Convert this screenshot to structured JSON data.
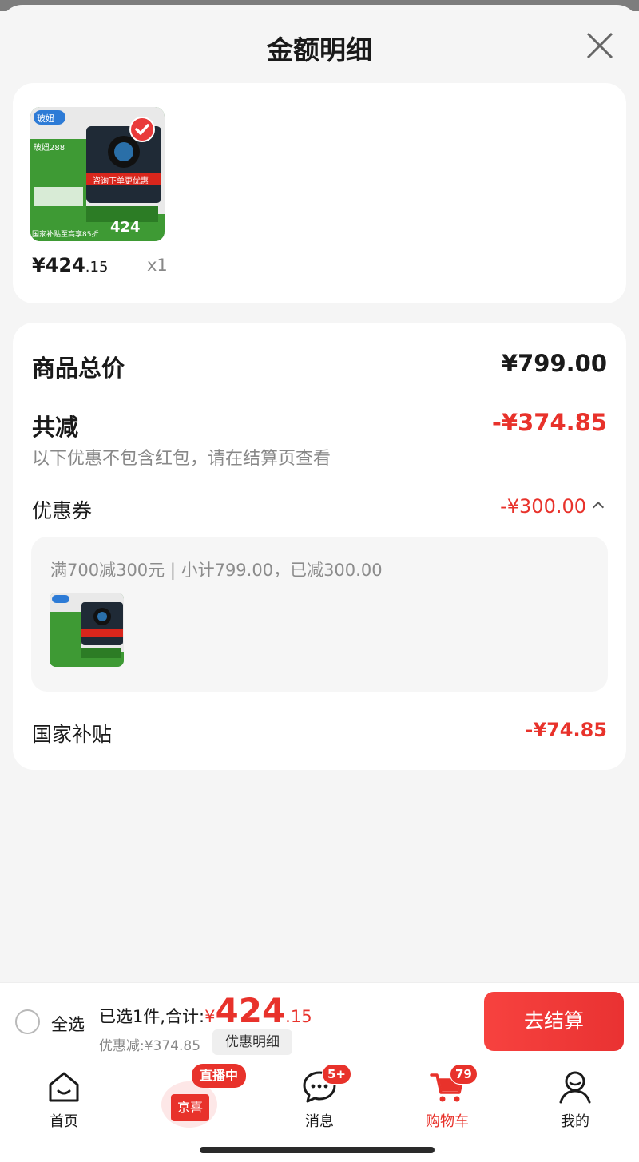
{
  "sheet": {
    "title": "金额明细"
  },
  "product": {
    "price_int": "¥424",
    "price_dec": ".15",
    "qty": "x1",
    "thumb_labels": {
      "brand": "玻妞",
      "model": "玻妞288",
      "banner": "咨询下单更优惠",
      "price": "424",
      "subsidy": "国家补贴至高享85折"
    }
  },
  "detail": {
    "goods_total_label": "商品总价",
    "goods_total_value": "¥799.00",
    "reduced_label": "共减",
    "reduced_value": "-¥374.85",
    "note": "以下优惠不包含红包，请在结算页查看",
    "coupon_label": "优惠券",
    "coupon_value": "-¥300.00",
    "coupon_desc": "满700减300元 | 小计799.00，已减300.00",
    "subsidy_label": "国家补贴",
    "subsidy_value": "-¥74.85"
  },
  "settle": {
    "select_all": "全选",
    "selected_prefix": "已选1件,合计:",
    "currency": "¥",
    "total_int": "424",
    "total_dec": ".15",
    "discount": "优惠减:¥374.85",
    "detail_chip": "优惠明细",
    "checkout": "去结算"
  },
  "tabbar": {
    "home": "首页",
    "live_badge": "直播中",
    "live_label": "京喜",
    "messages": "消息",
    "messages_badge": "5+",
    "cart": "购物车",
    "cart_badge": "79",
    "me": "我的"
  },
  "colors": {
    "accent_red": "#e8322b",
    "text_dark": "#1a1a1a",
    "text_gray": "#888888"
  }
}
